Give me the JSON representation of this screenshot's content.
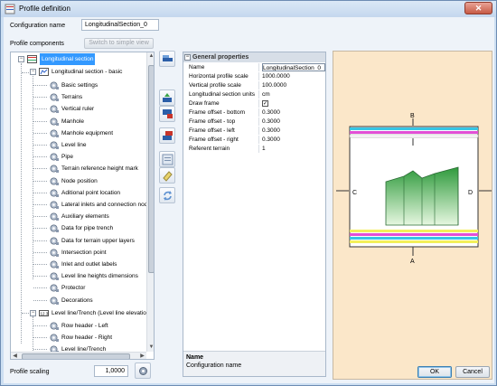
{
  "window": {
    "title": "Profile definition",
    "close_glyph": "✕"
  },
  "config": {
    "label": "Configuration name",
    "value": "LongitudinalSection_0"
  },
  "components": {
    "label": "Profile components",
    "switch_button": "Switch to simple view"
  },
  "tree": {
    "root": "Longitudinal section",
    "group": "Longitudinal section - basic",
    "items": [
      {
        "label": "Basic settings",
        "icon": "gear-icon"
      },
      {
        "label": "Terrains",
        "icon": "gear-icon"
      },
      {
        "label": "Vertical ruler",
        "icon": "gear-icon"
      },
      {
        "label": "Manhole",
        "icon": "gear-icon"
      },
      {
        "label": "Manhole equipment",
        "icon": "gear-icon"
      },
      {
        "label": "Level line",
        "icon": "gear-icon"
      },
      {
        "label": "Pipe",
        "icon": "gear-icon"
      },
      {
        "label": "Terrain reference height mark",
        "icon": "gear-icon"
      },
      {
        "label": "Node position",
        "icon": "gear-icon"
      },
      {
        "label": "Aditional point location",
        "icon": "gear-icon"
      },
      {
        "label": "Lateral inlets and connection nodes",
        "icon": "gear-icon"
      },
      {
        "label": "Auxiliary elements",
        "icon": "gear-icon"
      },
      {
        "label": "Data for pipe trench",
        "icon": "gear-icon"
      },
      {
        "label": "Data for terrain upper layers",
        "icon": "gear-icon"
      },
      {
        "label": "Intersection point",
        "icon": "gear-icon"
      },
      {
        "label": "Inlet and outlet labels",
        "icon": "gear-icon"
      },
      {
        "label": "Level line heights dimensions",
        "icon": "gear-icon"
      },
      {
        "label": "Protector",
        "icon": "gear-icon"
      },
      {
        "label": "Decorations",
        "icon": "gear-icon"
      }
    ],
    "group2": "Level line/Trench (Level line elevation)",
    "group2_items": [
      {
        "label": "Row header - Left",
        "icon": "gear-icon"
      },
      {
        "label": "Row header - Right",
        "icon": "gear-icon"
      },
      {
        "label": "Level line/Trench",
        "icon": "gear-icon"
      }
    ]
  },
  "properties": {
    "section": "General properties",
    "rows": [
      {
        "key": "Name",
        "value": "LongitudinalSection_0"
      },
      {
        "key": "Horizontal profile scale",
        "value": "1000.0000"
      },
      {
        "key": "Vertical profile scale",
        "value": "100.0000"
      },
      {
        "key": "Longitudinal section units",
        "value": "cm"
      },
      {
        "key": "Draw frame",
        "value": "✓"
      },
      {
        "key": "Frame offset - bottom",
        "value": "0.3000"
      },
      {
        "key": "Frame offset - top",
        "value": "0.3000"
      },
      {
        "key": "Frame offset - left",
        "value": "0.3000"
      },
      {
        "key": "Frame offset - right",
        "value": "0.3000"
      },
      {
        "key": "Referent terrain",
        "value": "1"
      }
    ],
    "desc_title": "Name",
    "desc_text": "Configuration name"
  },
  "preview": {
    "labels": {
      "top": "B",
      "bottom": "A",
      "left": "C",
      "right": "D"
    },
    "colors": {
      "background": "#fbe7c9",
      "green": "#3cb54a",
      "cyan": "#37c6e6",
      "magenta": "#e24fd6",
      "yellow": "#f3f05a"
    }
  },
  "footer": {
    "scaling_label": "Profile scaling",
    "scaling_value": "1,0000",
    "ok": "OK",
    "cancel": "Cancel"
  }
}
